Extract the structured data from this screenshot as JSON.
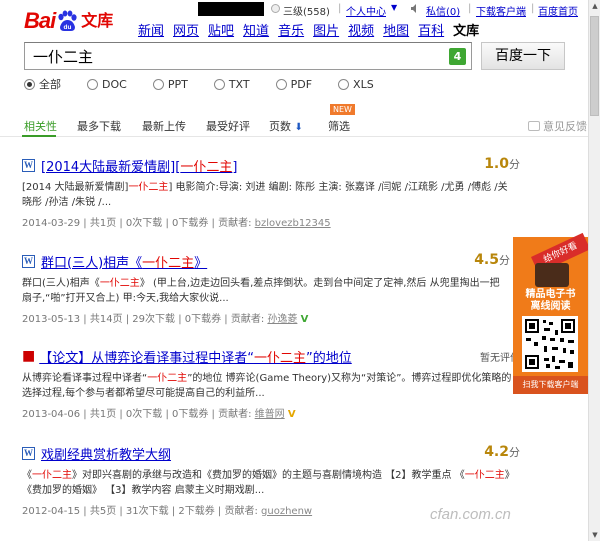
{
  "topbar": {
    "username": "",
    "level": "三级(558)",
    "personal_center": "个人中心",
    "messages": "私信(0)",
    "download_client": "下载客户端",
    "homepage": "百度首页"
  },
  "logo": {
    "bai": "Bai",
    "du": "du",
    "wenku": "文库"
  },
  "nav": [
    "新闻",
    "网页",
    "贴吧",
    "知道",
    "音乐",
    "图片",
    "视频",
    "地图",
    "百科",
    "文库"
  ],
  "nav_current": "文库",
  "search": {
    "query": "一仆二主",
    "count": "4",
    "button": "百度一下"
  },
  "filters": [
    {
      "label": "全部",
      "checked": true
    },
    {
      "label": "DOC",
      "checked": false
    },
    {
      "label": "PPT",
      "checked": false
    },
    {
      "label": "TXT",
      "checked": false
    },
    {
      "label": "PDF",
      "checked": false
    },
    {
      "label": "XLS",
      "checked": false
    }
  ],
  "tabs": {
    "relevance": "相关性",
    "most_downloads": "最多下载",
    "newest": "最新上传",
    "best_rated": "最受好评",
    "pages": "页数",
    "filter": "筛选",
    "new_badge": "NEW",
    "feedback": "意见反馈",
    "arrow": "⬇"
  },
  "results": [
    {
      "title_pre": "[2014大陆最新爱情剧][",
      "title_hl": "一仆二主",
      "title_post": "]",
      "score": "1.0",
      "score_unit": "分",
      "desc_parts": [
        "[2014 大陆最新爱情剧]",
        "一仆二主",
        "] 电影简介:导演: 刘进 编剧: 陈彤 主演: 张嘉译 /闫妮 /江疏影 /尤勇 /傅彪 /关晓彤 /孙洁 /朱锐 /..."
      ],
      "meta": "2014-03-29 | 共1页 | 0次下载 | 0下载券 | 贡献者: ",
      "uploader": "bzlovezb12345"
    },
    {
      "title_pre": "群口(三人)相声《",
      "title_hl": "一仆二主",
      "title_post": "》",
      "score": "4.5",
      "score_unit": "分",
      "desc_parts": [
        "群口(三人)相声《",
        "一仆二主",
        "》 (甲上台,边走边回头看,差点摔倒状。走到台中间定了定神,然后 从兜里掏出一把扇子,“啪”打开又合上) 甲:今天,我给大家伙说..."
      ],
      "meta": "2013-05-13 | 共14页 | 29次下载 | 0下载券 | 贡献者: ",
      "uploader": "孙逸菱"
    },
    {
      "title_pre": "【论文】从博弈论看译事过程中译者“",
      "title_hl": "一仆二主",
      "title_post": "”的地位",
      "no_score": "暂无评价",
      "desc_parts": [
        "从博弈论看译事过程中译者“",
        "一仆二主",
        "”的地位 博弈论(Game Theory)又称为“对策论”。博弈过程即优化策略的选择过程,每个参与者都希望尽可能提高自己的利益所..."
      ],
      "meta": "2013-04-06 | 共1页 | 0次下载 | 0下载券 | 贡献者: ",
      "uploader": "维普网"
    },
    {
      "title_pre": "戏剧经典赏析教学大纲",
      "title_hl": "",
      "title_post": "",
      "score": "4.2",
      "score_unit": "分",
      "desc_parts": [
        "《",
        "一仆二主",
        "》对即兴喜剧的承继与改造和《费加罗的婚姻》的主题与喜剧情境构造 【2】教学重点 《",
        "一仆二主",
        "》《费加罗的婚姻》 【3】教学内容 启蒙主义时期戏剧..."
      ],
      "meta": "2012-04-15 | 共5页 | 31次下载 | 2下载券 | 贡献者: ",
      "uploader": "guozhenw"
    }
  ],
  "ad": {
    "ribbon": "给你好看",
    "title1": "精品电子书",
    "title2": "离线阅读",
    "bottom": "扫我下载客户端"
  },
  "watermark": "cfan.com.cn",
  "colors": {
    "accent_green": "#3a9c28",
    "brand_red": "#e10602",
    "link_blue": "#0000cc",
    "score_gold": "#b8860b"
  }
}
